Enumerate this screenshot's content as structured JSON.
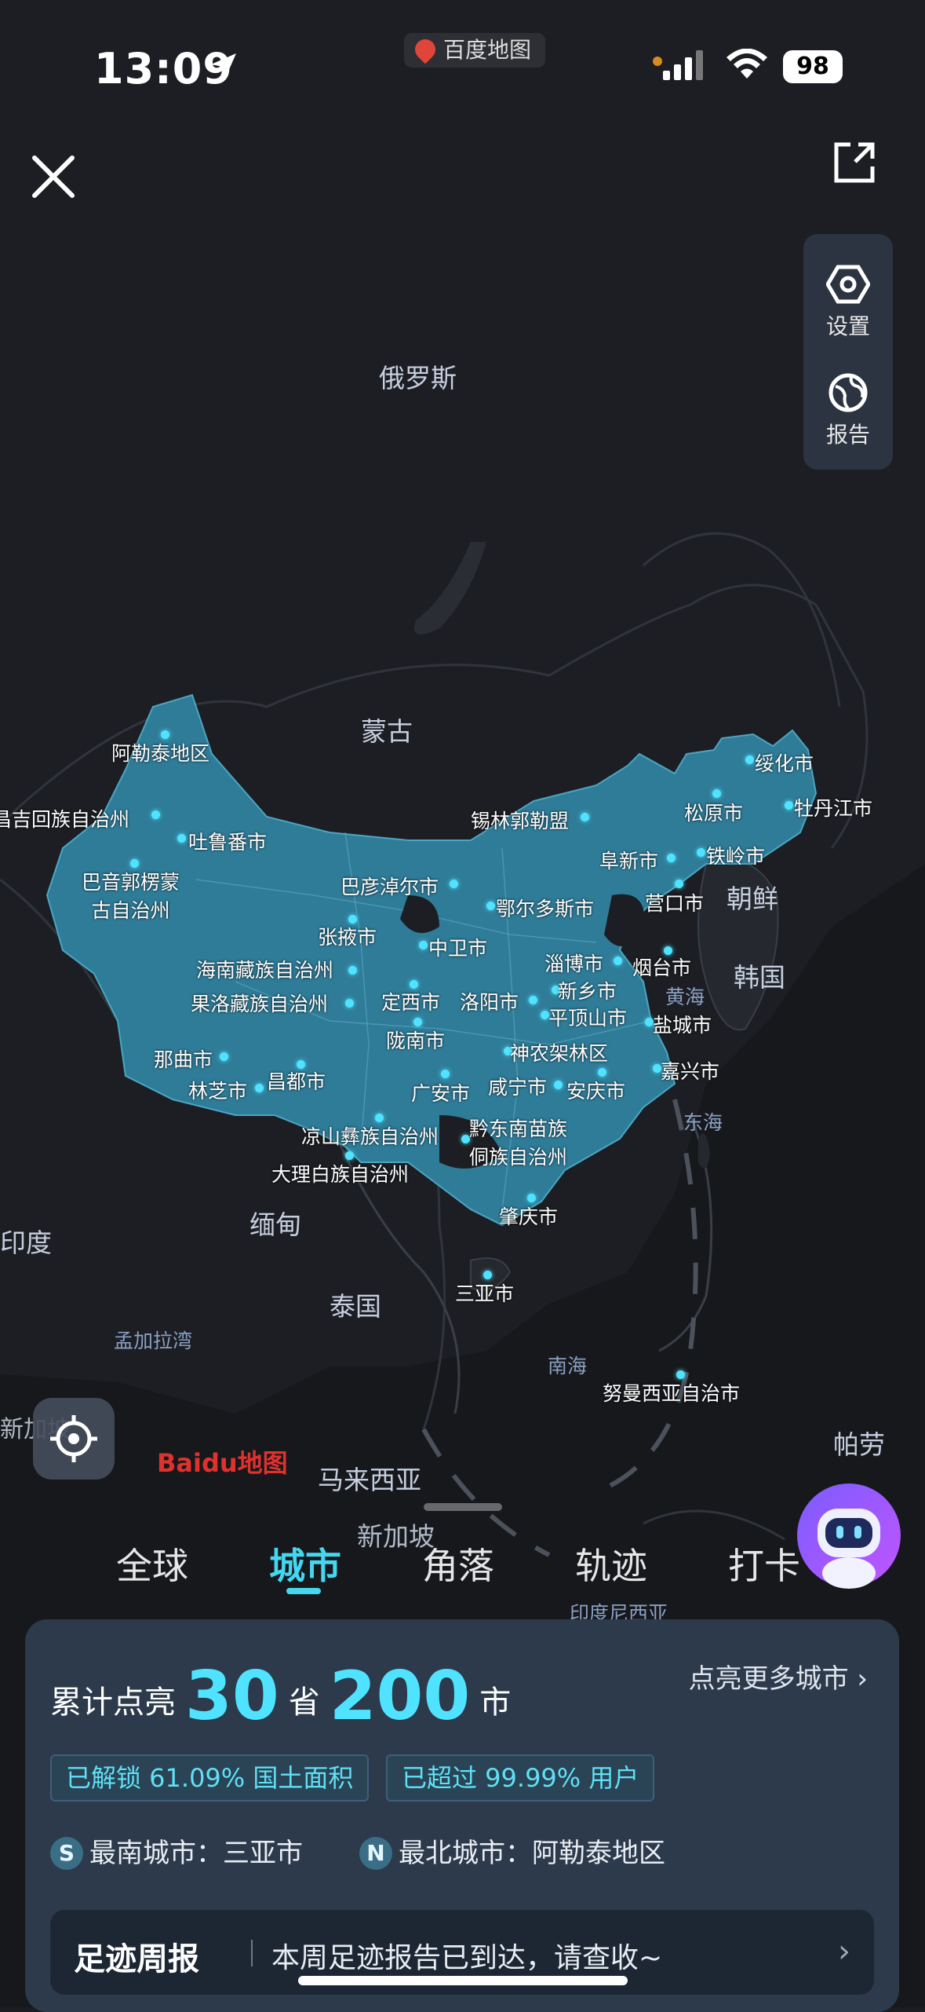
{
  "status_bar": {
    "time": "13:09",
    "app_name": "百度地图",
    "battery": "98"
  },
  "side_panel": {
    "settings_label": "设置",
    "report_label": "报告"
  },
  "map": {
    "countries": [
      "俄罗斯",
      "蒙古",
      "朝鲜",
      "韩国",
      "缅甸",
      "泰国",
      "印度",
      "马来西亚",
      "新加坡",
      "帕劳",
      "孟加拉湾",
      "印度尼西亚"
    ],
    "seas": [
      "黄海",
      "东海",
      "南海"
    ],
    "edge_labels": {
      "left_top": "昌吉回族自治州",
      "left_bottom": "新加坡"
    },
    "cities": {
      "aletai": "阿勒泰地区",
      "changji": "昌吉回族自治州",
      "tulufan": "吐鲁番市",
      "bayinguoleng": "巴音郭楞蒙\n古自治州",
      "xilinguole": "锡林郭勒盟",
      "suihua": "绥化市",
      "songyuan": "松原市",
      "mudanjiang": "牡丹江市",
      "fuxin": "阜新市",
      "tieling": "铁岭市",
      "yingkou": "营口市",
      "bayannaoer": "巴彦淖尔市",
      "eerduosi": "鄂尔多斯市",
      "zhangye": "张掖市",
      "zhongwei": "中卫市",
      "hainan_zz": "海南藏族自治州",
      "guoluo": "果洛藏族自治州",
      "dingxi": "定西市",
      "luoyang": "洛阳市",
      "zibo": "淄博市",
      "yantai": "烟台市",
      "xinxiang": "新乡市",
      "pingdingshan": "平顶山市",
      "yancheng": "盐城市",
      "longnan": "陇南市",
      "shennongjia": "神农架林区",
      "jiaxing": "嘉兴市",
      "naqu": "那曲市",
      "linzhi": "林芝市",
      "changdu": "昌都市",
      "guangan": "广安市",
      "xianning": "咸宁市",
      "anqing": "安庆市",
      "liangshan": "凉山彝族自治州",
      "qiandongnan": "黔东南苗族\n侗族自治州",
      "dali": "大理白族自治州",
      "zhaoqing": "肇庆市",
      "sanya": "三亚市",
      "nusanhara": "努曼西亚自治市"
    },
    "logo": "Baidu地图"
  },
  "tabs": [
    "全球",
    "城市",
    "角落",
    "轨迹",
    "打卡"
  ],
  "active_tab": "城市",
  "summary": {
    "prefix": "累计点亮",
    "provinces": "30",
    "province_unit": "省",
    "cities": "200",
    "city_unit": "市",
    "more_link": "点亮更多城市",
    "chip_area": "已解锁 61.09% 国土面积",
    "chip_users": "已超过 99.99% 用户",
    "south_badge": "S",
    "south_label": "最南城市：",
    "south_city": "三亚市",
    "north_badge": "N",
    "north_label": "最北城市：",
    "north_city": "阿勒泰地区"
  },
  "weekly_report": {
    "title": "足迹周报",
    "text": "本周足迹报告已到达，请查收~"
  },
  "colors": {
    "accent": "#44d7f0",
    "china_fill": "#2f7c98",
    "background": "#1b1d22",
    "card": "#2c3a4b"
  }
}
